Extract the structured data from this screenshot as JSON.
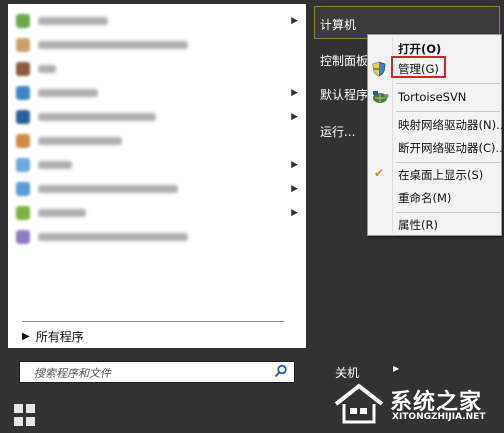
{
  "start_menu": {
    "all_programs_label": "所有程序",
    "search_placeholder": "搜索程序和文件",
    "shutdown_label": "关机"
  },
  "right_panel": {
    "items": [
      "计算机",
      "控制面板",
      "默认程序",
      "运行..."
    ]
  },
  "context_menu": {
    "items": [
      {
        "label": "打开(O)"
      },
      {
        "label": "管理(G)"
      },
      {
        "label": "TortoiseSVN"
      },
      {
        "label": "映射网络驱动器(N)..."
      },
      {
        "label": "断开网络驱动器(C)..."
      },
      {
        "label": "在桌面上显示(S)"
      },
      {
        "label": "重命名(M)"
      },
      {
        "label": "属性(R)"
      }
    ]
  },
  "watermark": {
    "title": "系统之家",
    "url": "XITONGZHIJIA.NET"
  },
  "colors": {
    "panel_bg": "#323232",
    "highlight_border": "#9a7a3a",
    "red_box": "#d42424"
  }
}
